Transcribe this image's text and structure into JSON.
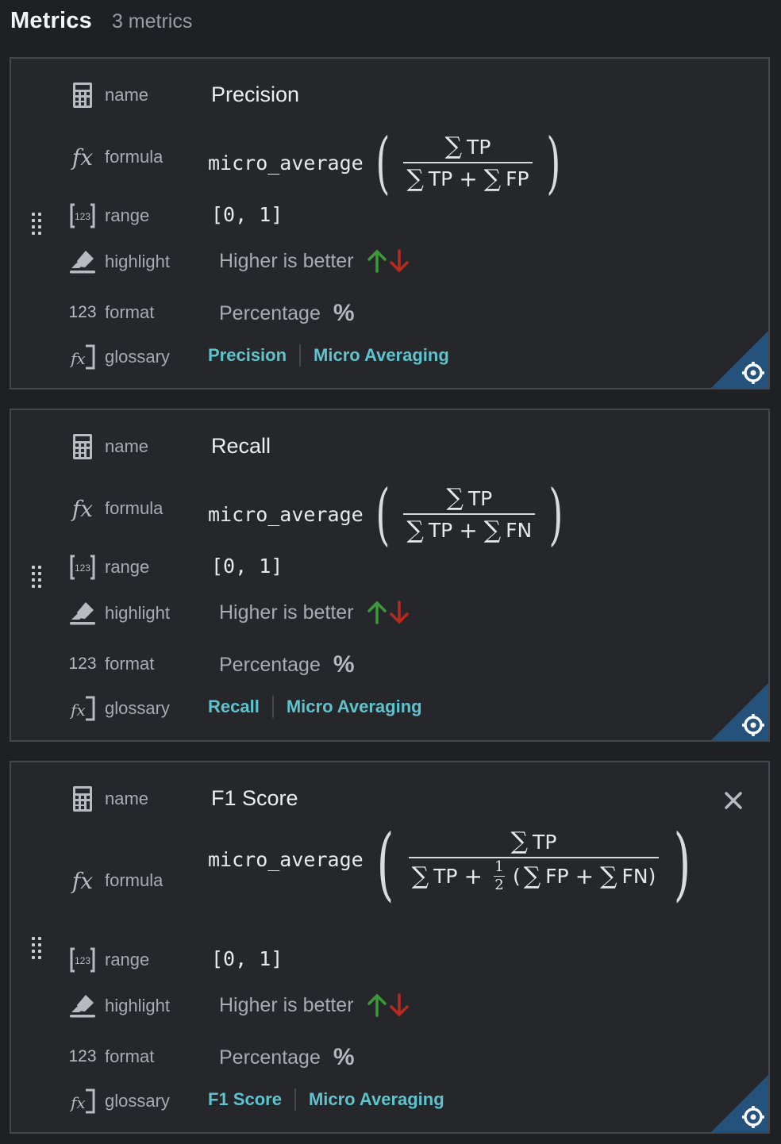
{
  "header": {
    "title": "Metrics",
    "count": "3 metrics"
  },
  "labels": {
    "name": "name",
    "formula": "formula",
    "range": "range",
    "highlight": "highlight",
    "format": "format",
    "glossary": "glossary"
  },
  "icons": {
    "name": "calculator-icon",
    "formula": "function-fx-icon",
    "range": "brackets-123-icon",
    "highlight": "highlighter-icon",
    "format": "numbers-123-icon",
    "glossary": "fx-bracket-icon",
    "drag": "drag-handle-icon",
    "corner": "target-crosshair-icon",
    "close": "close-icon",
    "up": "arrow-up-icon",
    "down": "arrow-down-icon"
  },
  "colors": {
    "accent_link": "#5fc3cd",
    "arrow_up": "#3d9a3a",
    "arrow_down": "#b8291f",
    "corner": "#24527a"
  },
  "metrics": [
    {
      "name": "Precision",
      "formula": {
        "fn": "micro_average",
        "numerator": "TP",
        "denominator": [
          "TP",
          "+",
          "FP"
        ],
        "text": "micro_average(∑TP / (∑TP + ∑FP))"
      },
      "range": "[0, 1]",
      "highlight": "Higher is better",
      "format": "Percentage",
      "format_symbol": "%",
      "glossary": [
        "Precision",
        "Micro Averaging"
      ],
      "closable": false
    },
    {
      "name": "Recall",
      "formula": {
        "fn": "micro_average",
        "numerator": "TP",
        "denominator": [
          "TP",
          "+",
          "FN"
        ],
        "text": "micro_average(∑TP / (∑TP + ∑FN))"
      },
      "range": "[0, 1]",
      "highlight": "Higher is better",
      "format": "Percentage",
      "format_symbol": "%",
      "glossary": [
        "Recall",
        "Micro Averaging"
      ],
      "closable": false
    },
    {
      "name": "F1 Score",
      "formula": {
        "fn": "micro_average",
        "numerator": "TP",
        "denominator": [
          "TP",
          "+",
          "1/2",
          "(FP + FN)"
        ],
        "text": "micro_average(∑TP / (∑TP + 1/2 (∑FP + ∑FN)))"
      },
      "range": "[0, 1]",
      "highlight": "Higher is better",
      "format": "Percentage",
      "format_symbol": "%",
      "glossary": [
        "F1 Score",
        "Micro Averaging"
      ],
      "closable": true
    }
  ],
  "formula_parts": {
    "sigma": "∑",
    "plus": "+",
    "half_num": "1",
    "half_den": "2",
    "lparen": "(",
    "rparen": ")",
    "tp": "TP",
    "fp": "FP",
    "fn": "FN"
  }
}
